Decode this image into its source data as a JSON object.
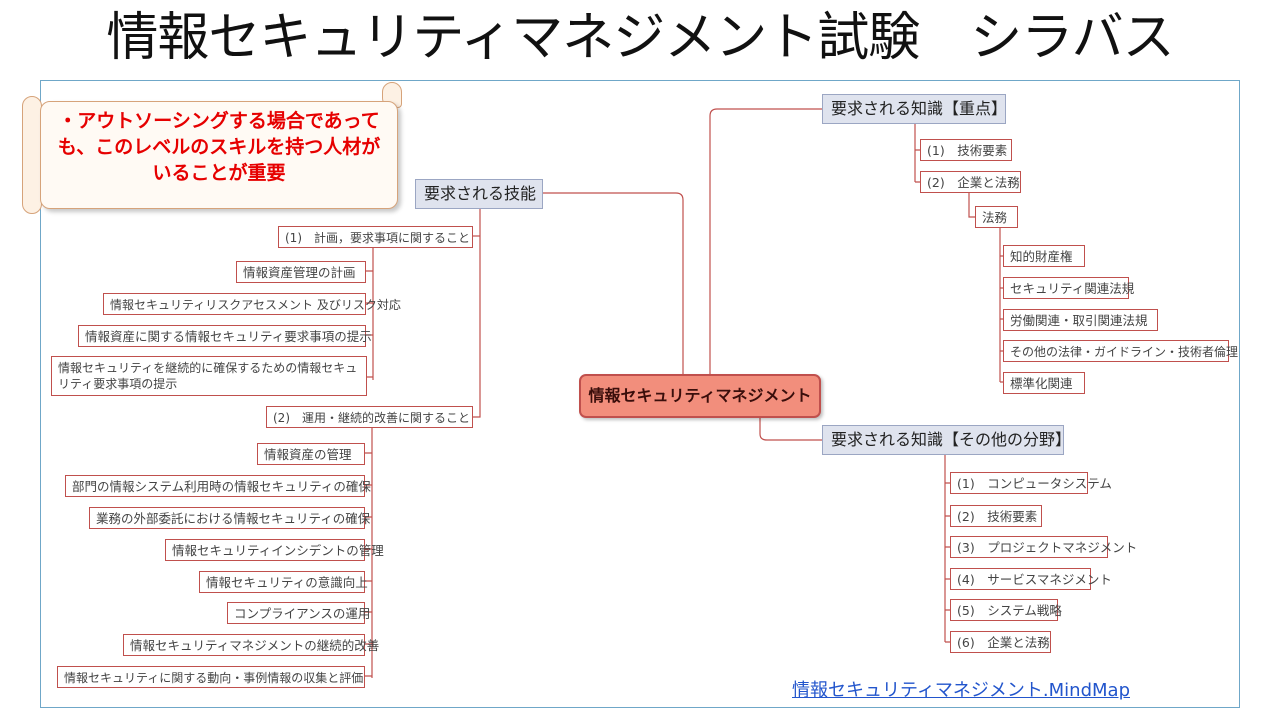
{
  "title": "情報セキュリティマネジメント試験　シラバス",
  "note_text": "・アウトソーシングする場合であっても、このレベルのスキルを持つ人材がいることが重要",
  "root": "情報セキュリティマネジメント",
  "left_branch": {
    "label": "要求される技能",
    "group1": {
      "label": "(1)　計画，要求事項に関すること",
      "items": [
        "情報資産管理の計画",
        "情報セキュリティリスクアセスメント 及びリスク対応",
        "情報資産に関する情報セキュリティ要求事項の提示",
        "情報セキュリティを継続的に確保するための情報セキュリティ要求事項の提示"
      ]
    },
    "group2": {
      "label": "(2)　運用・継続的改善に関すること",
      "items": [
        "情報資産の管理",
        "部門の情報システム利用時の情報セキュリティの確保",
        "業務の外部委託における情報セキュリティの確保",
        "情報セキュリティインシデントの管理",
        "情報セキュリティの意識向上",
        "コンプライアンスの運用",
        "情報セキュリティマネジメントの継続的改善",
        "情報セキュリティに関する動向・事例情報の収集と評価"
      ]
    }
  },
  "right_top": {
    "label": "要求される知識【重点】",
    "items": [
      "(1)　技術要素",
      "(2)　企業と法務"
    ],
    "law": {
      "label": "法務",
      "items": [
        "知的財産権",
        "セキュリティ関連法規",
        "労働関連・取引関連法規",
        "その他の法律・ガイドライン・技術者倫理",
        "標準化関連"
      ]
    }
  },
  "right_bottom": {
    "label": "要求される知識【その他の分野】",
    "items": [
      "(1)　コンピュータシステム",
      "(2)　技術要素",
      "(3)　プロジェクトマネジメント",
      "(4)　サービスマネジメント",
      "(5)　システム戦略",
      "(6)　企業と法務"
    ]
  },
  "link_text": "情報セキュリティマネジメント.MindMap",
  "colors": {
    "node_border": "#c0504d",
    "root_fill": "#f28e7c",
    "branch_fill": "#dfe3ee",
    "note_text": "#e60000",
    "link": "#2255cc",
    "frame": "#6fa7c8"
  }
}
